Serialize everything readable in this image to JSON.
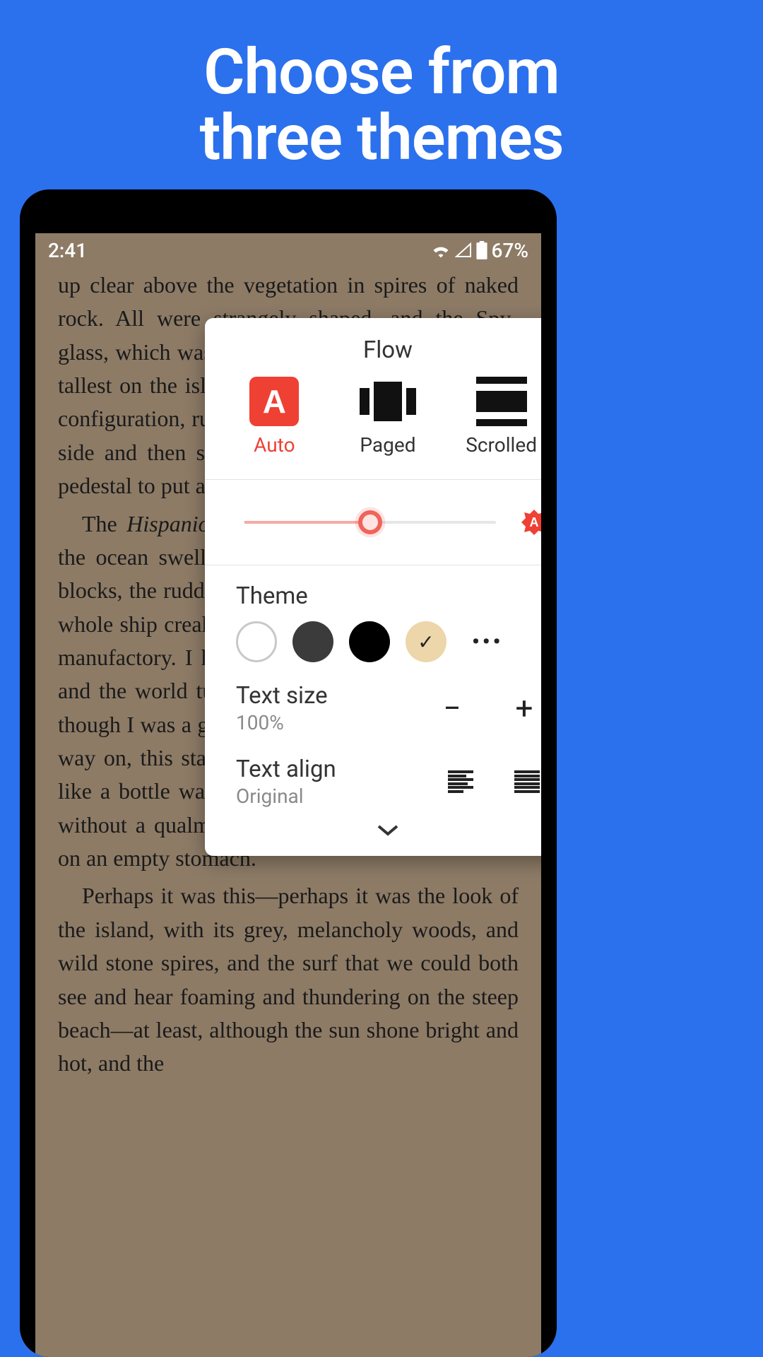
{
  "promo": {
    "line1": "Choose from",
    "line2": "three themes"
  },
  "status": {
    "time": "2:41",
    "battery": "67%"
  },
  "reader": {
    "p1": "up clear above the vegetation in spires of naked rock. All were strangely shaped, and the Spy-glass, which was by three or four hundred feet the tallest on the island, was likewise the strangest in configuration, running up sheer from almost every side and then suddenly cut off at the top like a pedestal to put a statue on.",
    "p2_a": "The ",
    "p2_em": "Hispaniola",
    "p2_b": " was rolling scuppers under in the ocean swell. The booms were tearing at the blocks, the rudder was banging to and fro, and the whole ship creaking, groaning, and jumping like a manufactory. I had to cling tight to the backstay, and the world turned giddily before my eyes, for though I was a good enough sailor when there was way on, this standing still and being rolled about like a bottle was a thing I never learned to stand without a qualm or so, above all in the morning, on an empty stomach.",
    "p3": "Perhaps it was this—perhaps it was the look of the island, with its grey, melancholy woods, and wild stone spires, and the surf that we could both see and hear foaming and thundering on the steep beach—at least, although the sun shone bright and hot, and the"
  },
  "panel": {
    "title": "Flow",
    "flow": {
      "auto": "Auto",
      "paged": "Paged",
      "scrolled": "Scrolled"
    },
    "brightness": {
      "value_percent": 50
    },
    "theme_label": "Theme",
    "themes": {
      "selected": "sepia"
    },
    "text_size": {
      "label": "Text size",
      "value": "100%"
    },
    "text_align": {
      "label": "Text align",
      "value": "Original"
    }
  }
}
